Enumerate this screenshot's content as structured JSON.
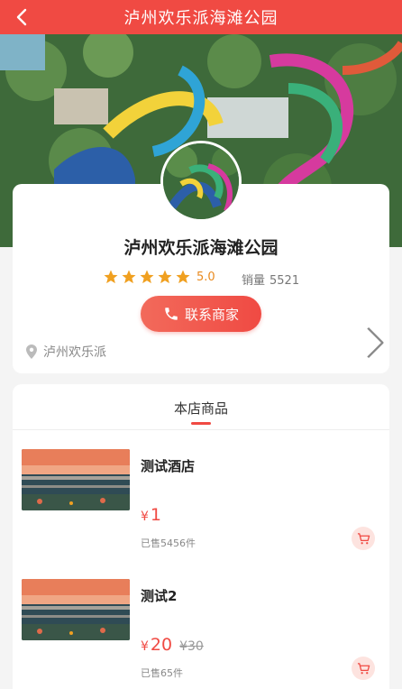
{
  "header": {
    "title": "泸州欢乐派海滩公园",
    "back_icon": "chevron-left-icon"
  },
  "store": {
    "name": "泸州欢乐派海滩公园",
    "rating": "5.0",
    "stars": 5,
    "sales_label": "销量",
    "sales_value": "5521",
    "contact_label": "联系商家",
    "location": "泸州欢乐派"
  },
  "tabs": [
    {
      "label": "本店商品",
      "active": true
    }
  ],
  "products": [
    {
      "name": "测试酒店",
      "currency": "¥",
      "price": "1",
      "original_price": "",
      "sold": "已售5456件"
    },
    {
      "name": "测试2",
      "currency": "¥",
      "price": "20",
      "original_price": "¥30",
      "sold": "已售65件"
    }
  ],
  "colors": {
    "accent": "#f04a43",
    "star": "#f0a020"
  }
}
